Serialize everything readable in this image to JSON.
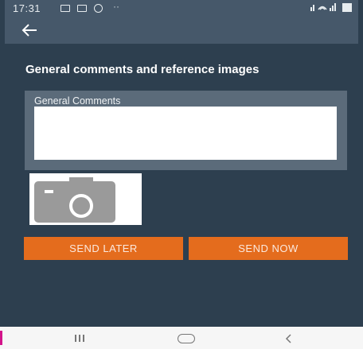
{
  "status_bar": {
    "time": "17:31",
    "dots": "··"
  },
  "toolbar": {
    "back_icon": "arrow-left-icon"
  },
  "page": {
    "title": "General comments and reference images"
  },
  "comments": {
    "label": "General Comments",
    "value": ""
  },
  "photo": {
    "icon": "camera-icon"
  },
  "buttons": {
    "send_later": "SEND LATER",
    "send_now": "SEND NOW"
  },
  "nav": {
    "recents_icon": "recents-icon",
    "home_icon": "home-icon",
    "back_icon": "back-chevron-icon"
  },
  "colors": {
    "background": "#2d3f4f",
    "toolbar": "#46586a",
    "card": "#5b6b7a",
    "accent": "#e46c1d"
  }
}
